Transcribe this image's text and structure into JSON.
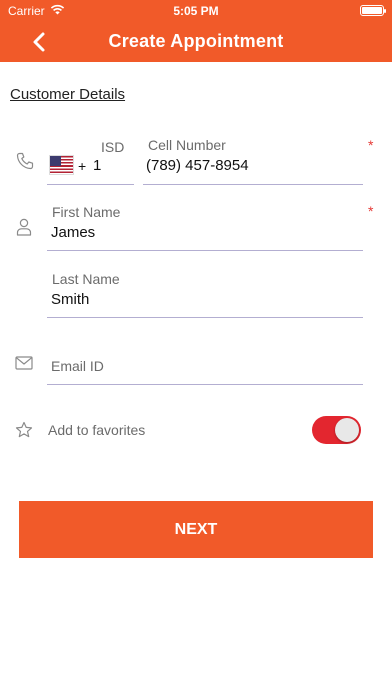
{
  "status_bar": {
    "carrier": "Carrier",
    "time": "5:05 PM",
    "battery_level": 1.0
  },
  "nav": {
    "title": "Create Appointment",
    "back_icon": "chevron-left-icon"
  },
  "section": {
    "title": "Customer Details"
  },
  "phone": {
    "icon": "phone-icon",
    "isd_label": "ISD",
    "flag": "us-flag-icon",
    "isd_plus": "+",
    "isd_code": "1",
    "cell_label": "Cell Number",
    "cell_value": "(789) 457-8954",
    "required_mark": "*"
  },
  "first_name": {
    "icon": "person-icon",
    "label": "First Name",
    "value": "James",
    "required_mark": "*"
  },
  "last_name": {
    "label": "Last Name",
    "value": "Smith"
  },
  "email": {
    "icon": "mail-icon",
    "label": "Email ID",
    "value": ""
  },
  "favorites": {
    "icon": "star-icon",
    "label": "Add to favorites",
    "enabled": true
  },
  "actions": {
    "next_label": "NEXT"
  },
  "colors": {
    "brand": "#f15a29",
    "toggle_on": "#e3262f",
    "required": "#e53935",
    "underline": "#b3aed1"
  }
}
